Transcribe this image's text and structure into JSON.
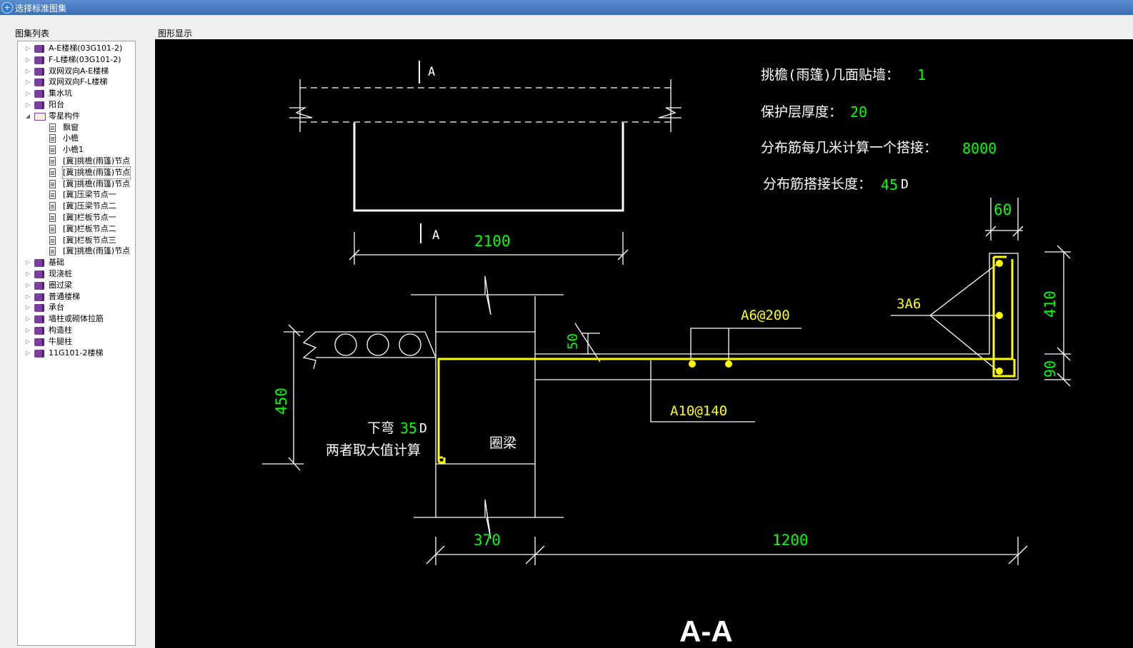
{
  "window": {
    "title": "选择标准图集"
  },
  "left_panel": {
    "label": "图集列表"
  },
  "right_panel": {
    "label": "图形显示"
  },
  "tree": [
    {
      "label": "A-E楼梯(03G101-2)",
      "level": 0,
      "icon": "book-icon",
      "expanded": false
    },
    {
      "label": "F-L楼梯(03G101-2)",
      "level": 0,
      "icon": "book-icon",
      "expanded": false
    },
    {
      "label": "双网双向A-E楼梯",
      "level": 0,
      "icon": "book-icon",
      "expanded": false
    },
    {
      "label": "双网双向F-L楼梯",
      "level": 0,
      "icon": "book-icon",
      "expanded": false
    },
    {
      "label": "集水坑",
      "level": 0,
      "icon": "book-icon",
      "expanded": false
    },
    {
      "label": "阳台",
      "level": 0,
      "icon": "book-icon",
      "expanded": false
    },
    {
      "label": "零星构件",
      "level": 0,
      "icon": "open-book-icon",
      "expanded": true
    },
    {
      "label": "飘窗",
      "level": 1,
      "icon": "document-icon"
    },
    {
      "label": "小檐",
      "level": 1,
      "icon": "document-icon"
    },
    {
      "label": "小檐1",
      "level": 1,
      "icon": "document-icon"
    },
    {
      "label": "[冀]挑檐(雨篷)节点",
      "level": 1,
      "icon": "document-icon"
    },
    {
      "label": "[冀]挑檐(雨篷)节点",
      "level": 1,
      "icon": "document-icon",
      "selected": true
    },
    {
      "label": "[冀]挑檐(雨篷)节点",
      "level": 1,
      "icon": "document-icon"
    },
    {
      "label": "[冀]压梁节点一",
      "level": 1,
      "icon": "document-icon"
    },
    {
      "label": "[冀]压梁节点二",
      "level": 1,
      "icon": "document-icon"
    },
    {
      "label": "[冀]栏板节点一",
      "level": 1,
      "icon": "document-icon"
    },
    {
      "label": "[冀]栏板节点二",
      "level": 1,
      "icon": "document-icon"
    },
    {
      "label": "[冀]栏板节点三",
      "level": 1,
      "icon": "document-icon"
    },
    {
      "label": "[冀]挑檐(雨篷)节点",
      "level": 1,
      "icon": "document-icon"
    },
    {
      "label": "基础",
      "level": 0,
      "icon": "book-icon",
      "expanded": false
    },
    {
      "label": "现浇桩",
      "level": 0,
      "icon": "book-icon",
      "expanded": false
    },
    {
      "label": "圈过梁",
      "level": 0,
      "icon": "book-icon",
      "expanded": false
    },
    {
      "label": "普通楼梯",
      "level": 0,
      "icon": "book-icon",
      "expanded": false
    },
    {
      "label": "承台",
      "level": 0,
      "icon": "book-icon",
      "expanded": false
    },
    {
      "label": "墙柱或砌体拉筋",
      "level": 0,
      "icon": "book-icon",
      "expanded": false
    },
    {
      "label": "构造柱",
      "level": 0,
      "icon": "book-icon",
      "expanded": false
    },
    {
      "label": "牛腿柱",
      "level": 0,
      "icon": "book-icon",
      "expanded": false
    },
    {
      "label": "11G101-2楼梯",
      "level": 0,
      "icon": "book-icon",
      "expanded": false
    }
  ],
  "drawing": {
    "params": [
      {
        "label": "挑檐(雨篷)几面贴墙：",
        "value": "1"
      },
      {
        "label": "保护层厚度：",
        "value": "20"
      },
      {
        "label": "分布筋每几米计算一个搭接：",
        "value": "8000"
      },
      {
        "label": "分布筋搭接长度：",
        "value": "45",
        "suffix": "D"
      }
    ],
    "section_mark": "A",
    "section_title": "A-A",
    "dims": {
      "plan_width": "2100",
      "width_60": "60",
      "height_410": "410",
      "height_90": "90",
      "height_50": "50",
      "height_450": "450",
      "width_370": "370",
      "width_1200": "1200"
    },
    "rebar": {
      "distribution": "A6@200",
      "main": "A10@140",
      "edge": "3A6"
    },
    "notes": {
      "bend_prefix": "下弯",
      "bend_value": "35",
      "bend_suffix": "D",
      "take_max": "两者取大值计算",
      "ring_beam": "圈梁"
    },
    "colors": {
      "background": "#000000",
      "line": "#ffffff",
      "rebar": "#ffff00",
      "value": "#00ff00",
      "rebar_label": "#ffff00"
    }
  }
}
